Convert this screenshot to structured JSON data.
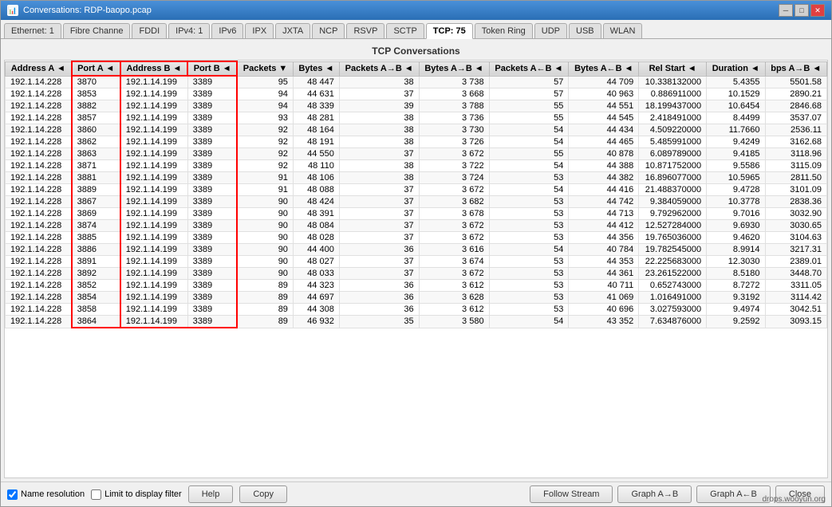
{
  "window": {
    "title": "Conversations: RDP-baopo.pcap",
    "icon": "📊"
  },
  "titlebar": {
    "minimize": "─",
    "maximize": "□",
    "close": "✕"
  },
  "tabs": [
    {
      "label": "Ethernet: 1",
      "active": false
    },
    {
      "label": "Fibre Channe",
      "active": false
    },
    {
      "label": "FDDI",
      "active": false
    },
    {
      "label": "IPv4: 1",
      "active": false
    },
    {
      "label": "IPv6",
      "active": false
    },
    {
      "label": "IPX",
      "active": false
    },
    {
      "label": "JXTA",
      "active": false
    },
    {
      "label": "NCP",
      "active": false
    },
    {
      "label": "RSVP",
      "active": false
    },
    {
      "label": "SCTP",
      "active": false
    },
    {
      "label": "TCP: 75",
      "active": true
    },
    {
      "label": "Token Ring",
      "active": false
    },
    {
      "label": "UDP",
      "active": false
    },
    {
      "label": "USB",
      "active": false
    },
    {
      "label": "WLAN",
      "active": false
    }
  ],
  "section_title": "TCP Conversations",
  "columns": [
    {
      "label": "Address A",
      "arrow": "◄"
    },
    {
      "label": "Port A",
      "arrow": "◄"
    },
    {
      "label": "Address B",
      "arrow": "◄"
    },
    {
      "label": "Port B",
      "arrow": "◄"
    },
    {
      "label": "Packets",
      "arrow": "▼"
    },
    {
      "label": "Bytes",
      "arrow": "◄"
    },
    {
      "label": "Packets A→B",
      "arrow": "◄"
    },
    {
      "label": "Bytes A→B",
      "arrow": "◄"
    },
    {
      "label": "Packets A←B",
      "arrow": "◄"
    },
    {
      "label": "Bytes A←B",
      "arrow": "◄"
    },
    {
      "label": "Rel Start",
      "arrow": "◄"
    },
    {
      "label": "Duration",
      "arrow": "◄"
    },
    {
      "label": "bps A→B",
      "arrow": "◄"
    }
  ],
  "rows": [
    [
      "192.1.14.228",
      "3870",
      "192.1.14.199",
      "3389",
      "95",
      "48 447",
      "38",
      "3 738",
      "57",
      "44 709",
      "10.338132000",
      "5.4355",
      "5501.58"
    ],
    [
      "192.1.14.228",
      "3853",
      "192.1.14.199",
      "3389",
      "94",
      "44 631",
      "37",
      "3 668",
      "57",
      "40 963",
      "0.886911000",
      "10.1529",
      "2890.21"
    ],
    [
      "192.1.14.228",
      "3882",
      "192.1.14.199",
      "3389",
      "94",
      "48 339",
      "39",
      "3 788",
      "55",
      "44 551",
      "18.199437000",
      "10.6454",
      "2846.68"
    ],
    [
      "192.1.14.228",
      "3857",
      "192.1.14.199",
      "3389",
      "93",
      "48 281",
      "38",
      "3 736",
      "55",
      "44 545",
      "2.418491000",
      "8.4499",
      "3537.07"
    ],
    [
      "192.1.14.228",
      "3860",
      "192.1.14.199",
      "3389",
      "92",
      "48 164",
      "38",
      "3 730",
      "54",
      "44 434",
      "4.509220000",
      "11.7660",
      "2536.11"
    ],
    [
      "192.1.14.228",
      "3862",
      "192.1.14.199",
      "3389",
      "92",
      "48 191",
      "38",
      "3 726",
      "54",
      "44 465",
      "5.485991000",
      "9.4249",
      "3162.68"
    ],
    [
      "192.1.14.228",
      "3863",
      "192.1.14.199",
      "3389",
      "92",
      "44 550",
      "37",
      "3 672",
      "55",
      "40 878",
      "6.089789000",
      "9.4185",
      "3118.96"
    ],
    [
      "192.1.14.228",
      "3871",
      "192.1.14.199",
      "3389",
      "92",
      "48 110",
      "38",
      "3 722",
      "54",
      "44 388",
      "10.871752000",
      "9.5586",
      "3115.09"
    ],
    [
      "192.1.14.228",
      "3881",
      "192.1.14.199",
      "3389",
      "91",
      "48 106",
      "38",
      "3 724",
      "53",
      "44 382",
      "16.896077000",
      "10.5965",
      "2811.50"
    ],
    [
      "192.1.14.228",
      "3889",
      "192.1.14.199",
      "3389",
      "91",
      "48 088",
      "37",
      "3 672",
      "54",
      "44 416",
      "21.488370000",
      "9.4728",
      "3101.09"
    ],
    [
      "192.1.14.228",
      "3867",
      "192.1.14.199",
      "3389",
      "90",
      "48 424",
      "37",
      "3 682",
      "53",
      "44 742",
      "9.384059000",
      "10.3778",
      "2838.36"
    ],
    [
      "192.1.14.228",
      "3869",
      "192.1.14.199",
      "3389",
      "90",
      "48 391",
      "37",
      "3 678",
      "53",
      "44 713",
      "9.792962000",
      "9.7016",
      "3032.90"
    ],
    [
      "192.1.14.228",
      "3874",
      "192.1.14.199",
      "3389",
      "90",
      "48 084",
      "37",
      "3 672",
      "53",
      "44 412",
      "12.527284000",
      "9.6930",
      "3030.65"
    ],
    [
      "192.1.14.228",
      "3885",
      "192.1.14.199",
      "3389",
      "90",
      "48 028",
      "37",
      "3 672",
      "53",
      "44 356",
      "19.765036000",
      "9.4620",
      "3104.63"
    ],
    [
      "192.1.14.228",
      "3886",
      "192.1.14.199",
      "3389",
      "90",
      "44 400",
      "36",
      "3 616",
      "54",
      "40 784",
      "19.782545000",
      "8.9914",
      "3217.31"
    ],
    [
      "192.1.14.228",
      "3891",
      "192.1.14.199",
      "3389",
      "90",
      "48 027",
      "37",
      "3 674",
      "53",
      "44 353",
      "22.225683000",
      "12.3030",
      "2389.01"
    ],
    [
      "192.1.14.228",
      "3892",
      "192.1.14.199",
      "3389",
      "90",
      "48 033",
      "37",
      "3 672",
      "53",
      "44 361",
      "23.261522000",
      "8.5180",
      "3448.70"
    ],
    [
      "192.1.14.228",
      "3852",
      "192.1.14.199",
      "3389",
      "89",
      "44 323",
      "36",
      "3 612",
      "53",
      "40 711",
      "0.652743000",
      "8.7272",
      "3311.05"
    ],
    [
      "192.1.14.228",
      "3854",
      "192.1.14.199",
      "3389",
      "89",
      "44 697",
      "36",
      "3 628",
      "53",
      "41 069",
      "1.016491000",
      "9.3192",
      "3114.42"
    ],
    [
      "192.1.14.228",
      "3858",
      "192.1.14.199",
      "3389",
      "89",
      "44 308",
      "36",
      "3 612",
      "53",
      "40 696",
      "3.027593000",
      "9.4974",
      "3042.51"
    ],
    [
      "192.1.14.228",
      "3864",
      "192.1.14.199",
      "3389",
      "89",
      "46 932",
      "35",
      "3 580",
      "54",
      "43 352",
      "7.634876000",
      "9.2592",
      "3093.15"
    ]
  ],
  "bottom": {
    "name_resolution_label": "Name resolution",
    "limit_display_label": "Limit to display filter",
    "help_label": "Help",
    "copy_label": "Copy",
    "follow_stream_label": "Follow Stream",
    "graph_ab_label": "Graph A→B",
    "graph_ba_label": "Graph A←B",
    "close_label": "Close"
  },
  "watermark": "drops.wooyun.org"
}
